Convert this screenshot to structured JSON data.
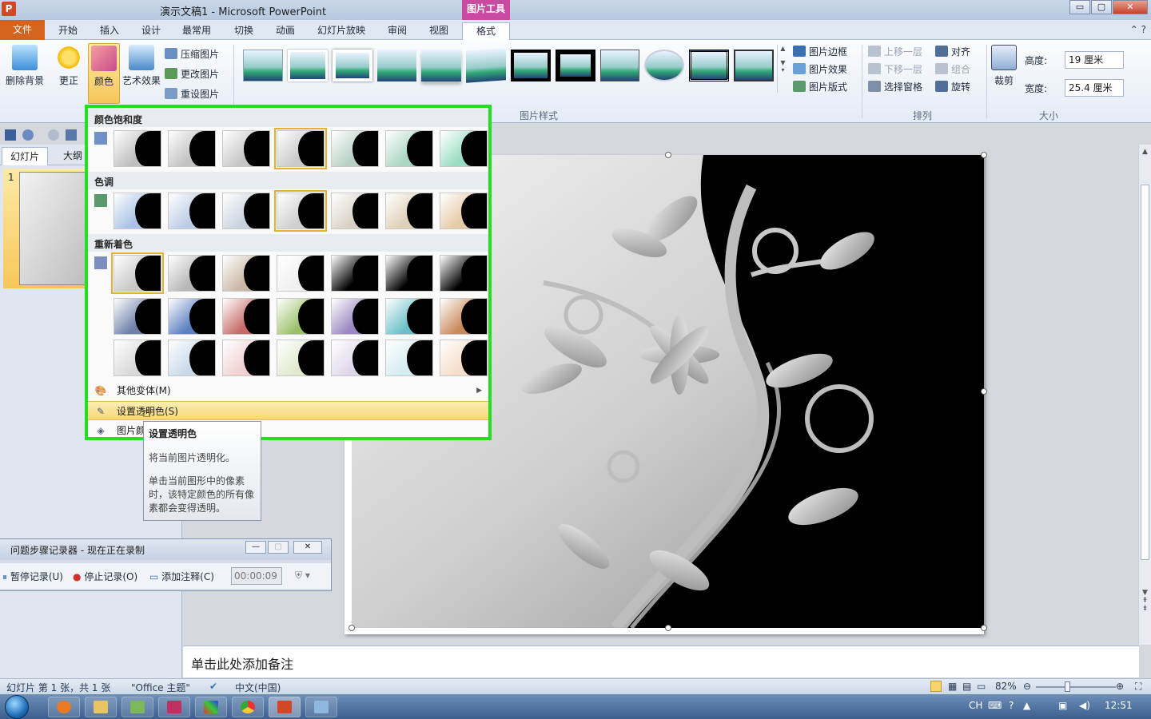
{
  "window": {
    "title": "演示文稿1 - Microsoft PowerPoint",
    "context_tab_group": "图片工具",
    "app_icon": "P",
    "min": "▭",
    "max": "▢",
    "close": "✕"
  },
  "tabs": [
    {
      "label": "文件"
    },
    {
      "label": "开始"
    },
    {
      "label": "插入"
    },
    {
      "label": "设计"
    },
    {
      "label": "最常用"
    },
    {
      "label": "切换"
    },
    {
      "label": "动画"
    },
    {
      "label": "幻灯片放映"
    },
    {
      "label": "审阅"
    },
    {
      "label": "视图"
    },
    {
      "label": "格式"
    }
  ],
  "ribbon": {
    "remove_bg": "删除背景",
    "corrections": "更正",
    "color": "颜色",
    "artistic": "艺术效果",
    "compress": "压缩图片",
    "change_pic": "更改图片",
    "reset_pic": "重设图片",
    "styles_group": "图片样式",
    "pic_border": "图片边框",
    "pic_effects": "图片效果",
    "pic_layout": "图片版式",
    "bring_forward": "上移一层",
    "send_backward": "下移一层",
    "selection_pane": "选择窗格",
    "align": "对齐",
    "group": "组合",
    "rotate": "旋转",
    "arrange_group": "排列",
    "crop": "裁剪",
    "height_label": "高度:",
    "height_value": "19 厘米",
    "width_label": "宽度:",
    "width_value": "25.4 厘米",
    "size_group": "大小"
  },
  "left_panel": {
    "tab_slides": "幻灯片",
    "tab_outline": "大纲",
    "slide_number": "1"
  },
  "color_menu": {
    "saturation_header": "颜色饱和度",
    "tone_header": "色调",
    "recolor_header": "重新着色",
    "more_variations": "其他变体(M)",
    "set_transparent": "设置透明色(S)",
    "picture_color_options": "图片颜色选项(C)...",
    "saturation_swatches": [
      "#bfbfbf",
      "#c2c2c2",
      "#c6c6c6",
      "#c9c9c9",
      "#b8cfc4",
      "#a9d6c2",
      "#98dcc2"
    ],
    "tone_swatches": [
      "#a9c2e6",
      "#bccde6",
      "#c9d3e0",
      "#cfcfcf",
      "#d8d2c6",
      "#dfcfb6",
      "#e6c9a6"
    ],
    "recolor_row1": [
      "#c8c8c8",
      "#b7b7b7",
      "#c9b7a5",
      "#f0f0f0",
      "#000000",
      "#000000",
      "#000000"
    ],
    "recolor_row2": [
      "#6f7fa8",
      "#5c7fc0",
      "#c86a6a",
      "#9cc06a",
      "#9a86c0",
      "#6ac0c8",
      "#c8895a"
    ],
    "recolor_row3": [
      "#d9d9d9",
      "#c9d9ea",
      "#f0d0d0",
      "#e0e9cf",
      "#e0d6ec",
      "#d3ecf0",
      "#f4ddc9"
    ],
    "selected_saturation": 3,
    "selected_tone": 3,
    "selected_recolor": 0
  },
  "tooltip": {
    "title": "设置透明色",
    "line1": "将当前图片透明化。",
    "line2": "单击当前图形中的像素时，该特定颜色的所有像素都会变得透明。"
  },
  "steps_recorder": {
    "title": "问题步骤记录器 - 现在正在录制",
    "pause": "暂停记录(U)",
    "stop": "停止记录(O)",
    "add_comment": "添加注释(C)",
    "timer": "00:00:09"
  },
  "notes_placeholder": "单击此处添加备注",
  "status": {
    "slide_info": "幻灯片 第 1 张，共 1 张",
    "theme": "\"Office 主题\"",
    "language": "中文(中国)",
    "zoom": "82%"
  },
  "taskbar": {
    "ime": "CH",
    "time": "12:51"
  },
  "colors": {
    "file_tab": "#d3631e",
    "context_tab": "#c94aa0",
    "highlight_border": "#21e021"
  }
}
